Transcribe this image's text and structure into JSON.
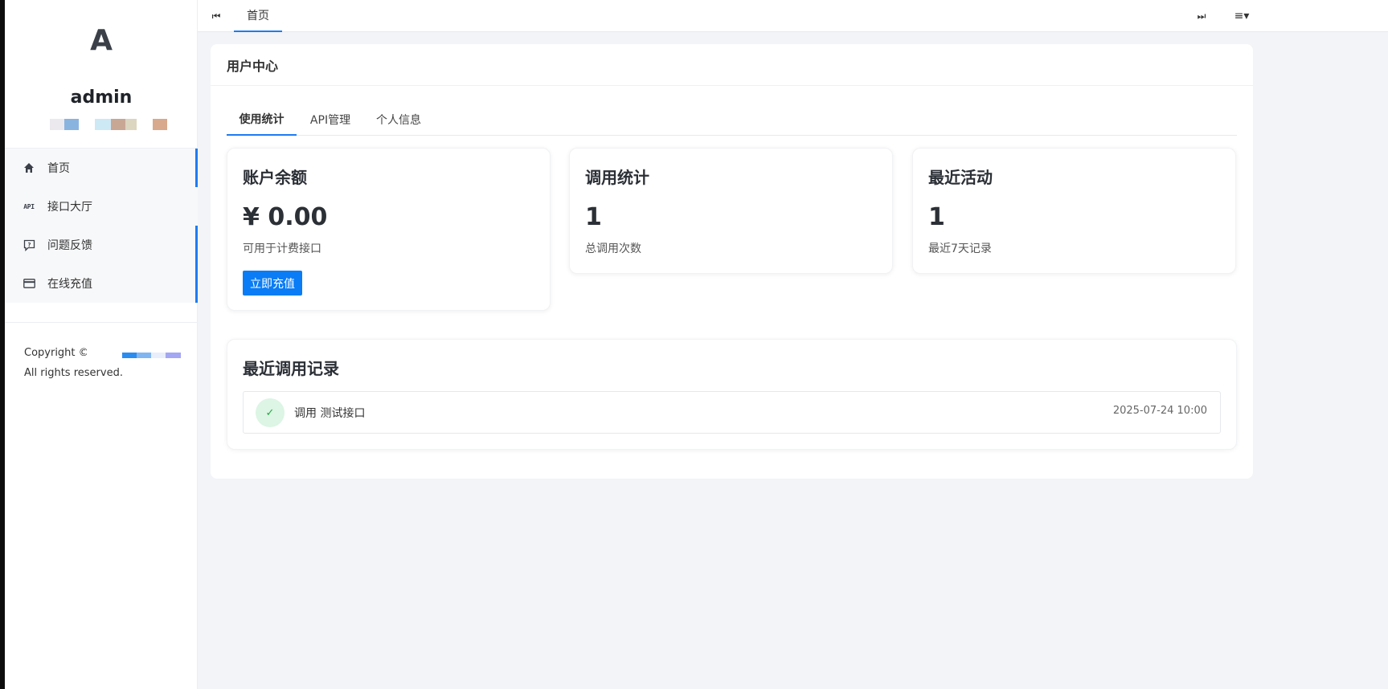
{
  "sidebar": {
    "logo": "A",
    "username": "admin",
    "menu": [
      {
        "label": "首页",
        "icon": "home-icon"
      },
      {
        "label": "接口大厅",
        "icon": "api-icon",
        "icon_text": "API"
      },
      {
        "label": "问题反馈",
        "icon": "feedback-icon"
      },
      {
        "label": "在线充值",
        "icon": "card-icon"
      }
    ],
    "copyright_line1": "Copyright © 2",
    "copyright_line2": "All rights reserved."
  },
  "topbar": {
    "prev_glyph": "⏮",
    "tab_label": "首页",
    "next_glyph": "⏭",
    "menu_glyph": "≡▾"
  },
  "main": {
    "title": "用户中心",
    "tabs": [
      "使用统计",
      "API管理",
      "个人信息"
    ],
    "active_tab": "使用统计",
    "stats": [
      {
        "title": "账户余额",
        "value": "¥ 0.00",
        "desc": "可用于计费接口",
        "button": "立即充值"
      },
      {
        "title": "调用统计",
        "value": "1",
        "desc": "总调用次数"
      },
      {
        "title": "最近活动",
        "value": "1",
        "desc": "最近7天记录"
      }
    ],
    "recent": {
      "title": "最近调用记录",
      "records": [
        {
          "icon": "✓",
          "text": "调用 测试接口",
          "time": "2025-07-24 10:00"
        }
      ]
    }
  },
  "colors": {
    "accent": "#1e7cf2",
    "button": "#0a7cf5",
    "success_bg": "#dcf5e4",
    "success": "#28a745",
    "page_bg": "#f3f4f8"
  }
}
